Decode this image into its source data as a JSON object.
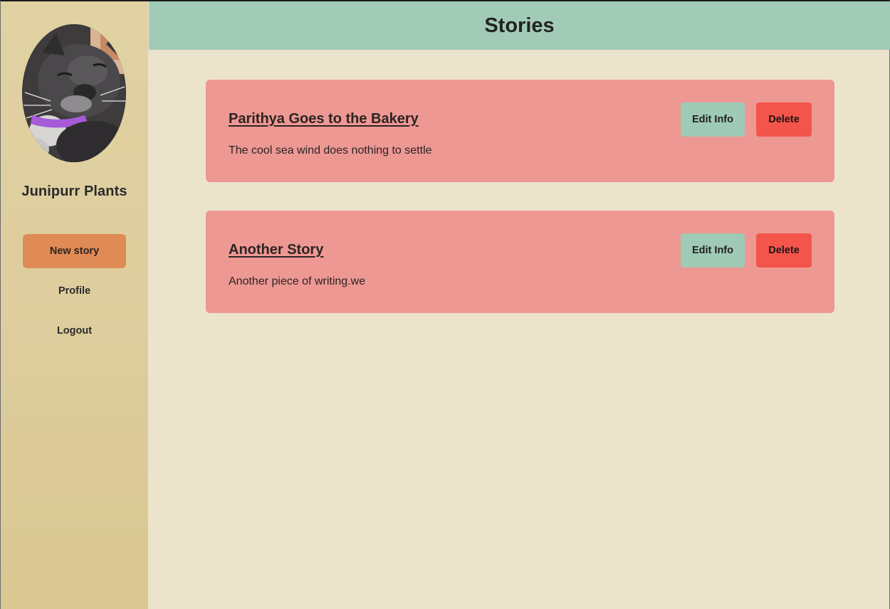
{
  "header": {
    "title": "Stories"
  },
  "sidebar": {
    "username": "Junipurr Plants",
    "new_story_label": "New story",
    "nav": [
      {
        "label": "Profile"
      },
      {
        "label": "Logout"
      }
    ]
  },
  "stories": [
    {
      "title": "Parithya Goes to the Bakery",
      "description": "The cool sea wind does nothing to settle",
      "edit_label": "Edit Info",
      "delete_label": "Delete"
    },
    {
      "title": "Another Story",
      "description": "Another piece of writing.we",
      "edit_label": "Edit Info",
      "delete_label": "Delete"
    }
  ],
  "colors": {
    "sidebar": "#ddcc9c",
    "header": "#a2cbb7",
    "background": "#ece3cc",
    "card": "#ee9893",
    "new_story_button": "#e08a56",
    "edit_button": "#9fcab5",
    "delete_button": "#f4554b"
  }
}
